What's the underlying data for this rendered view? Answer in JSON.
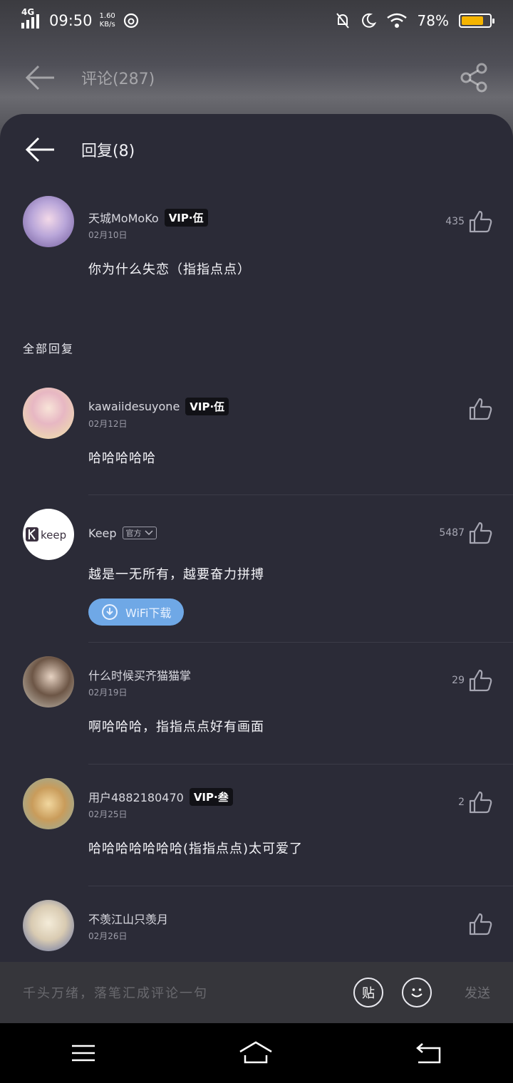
{
  "status": {
    "network": "4G",
    "time": "09:50",
    "speed": "1.60",
    "speed_unit": "KB/s",
    "battery": "78%",
    "battery_color": "#f5b400"
  },
  "top_header": {
    "title": "评论(287)"
  },
  "sheet": {
    "title": "回复(8)",
    "all_replies": "全部回复"
  },
  "comments": [
    {
      "name": "天城MoMoKo",
      "vip": "VIP·伍",
      "date": "02月10日",
      "text": "你为什么失恋（指指点点）",
      "likes": "435"
    },
    {
      "name": "kawaiidesuyone",
      "vip": "VIP·伍",
      "date": "02月12日",
      "text": "哈哈哈哈哈",
      "likes": ""
    },
    {
      "name": "Keep",
      "badge": "官方",
      "date": "",
      "text": "越是一无所有，越要奋力拼搏",
      "likes": "5487",
      "button": "WiFi下载"
    },
    {
      "name": "什么时候买齐猫猫掌",
      "vip": "",
      "date": "02月19日",
      "text": "啊哈哈哈，指指点点好有画面",
      "likes": "29"
    },
    {
      "name": "用户4882180470",
      "vip": "VIP·叁",
      "date": "02月25日",
      "text": "哈哈哈哈哈哈哈(指指点点)太可爱了",
      "likes": "2"
    },
    {
      "name": "不羡江山只羡月",
      "vip": "",
      "date": "02月26日",
      "text": "",
      "likes": ""
    }
  ],
  "input": {
    "placeholder": "千头万绪，落笔汇成评论一句",
    "sticker_label": "贴",
    "send_label": "发送"
  }
}
